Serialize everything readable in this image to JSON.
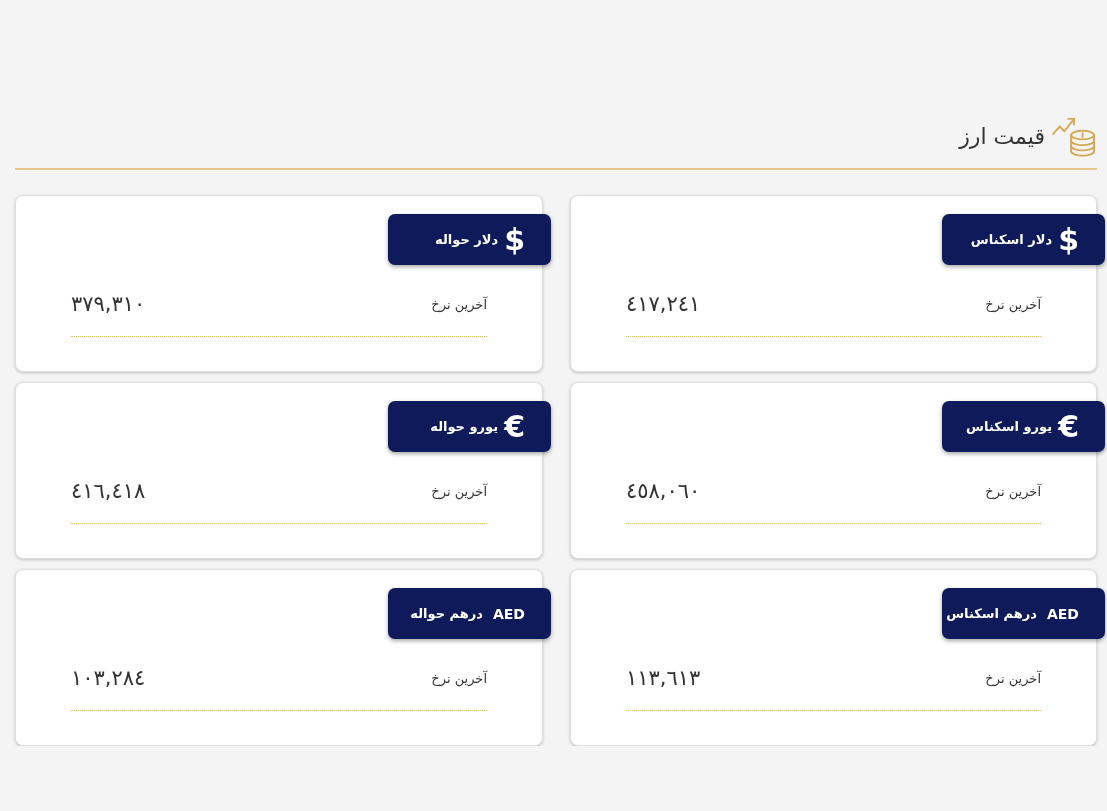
{
  "header": {
    "title": "قیمت ارز"
  },
  "cards": [
    {
      "title": "دلار اسکناس",
      "symbol": {
        "kind": "sign",
        "text": "$"
      },
      "label": "آخرین نرخ",
      "value": "٤١٧,٢٤١"
    },
    {
      "title": "دلار حواله",
      "symbol": {
        "kind": "sign",
        "text": "$"
      },
      "label": "آخرین نرخ",
      "value": "٣٧٩,٣١٠"
    },
    {
      "title": "یورو اسکناس",
      "symbol": {
        "kind": "sign",
        "text": "€"
      },
      "label": "آخرین نرخ",
      "value": "٤٥٨,٠٦٠"
    },
    {
      "title": "یورو حواله",
      "symbol": {
        "kind": "sign",
        "text": "€"
      },
      "label": "آخرین نرخ",
      "value": "٤١٦,٤١٨"
    },
    {
      "title": "درهم اسکناس",
      "symbol": {
        "kind": "code",
        "text": "AED"
      },
      "label": "آخرین نرخ",
      "value": "١١٣,٦١٣"
    },
    {
      "title": "درهم حواله",
      "symbol": {
        "kind": "code",
        "text": "AED"
      },
      "label": "آخرین نرخ",
      "value": "١٠٣,٢٨٤"
    }
  ]
}
